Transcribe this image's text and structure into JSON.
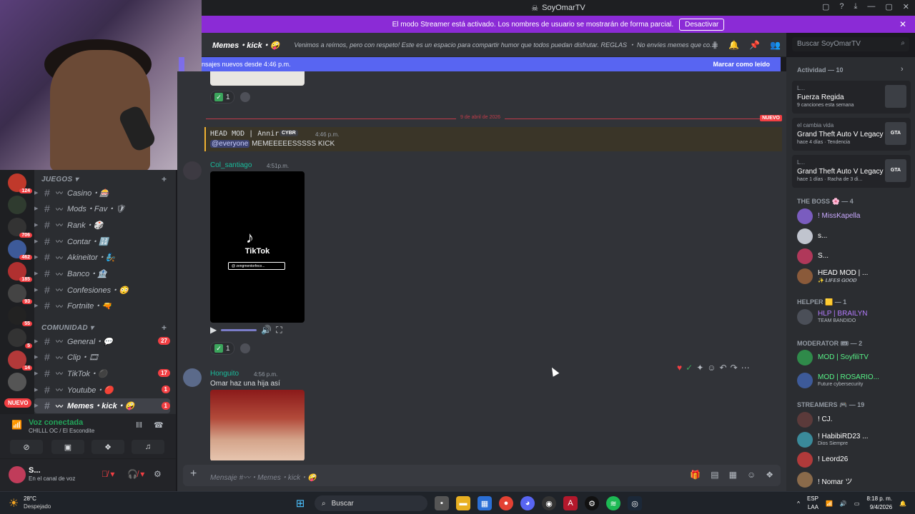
{
  "window": {
    "title": "SoyOmarTV",
    "controls": [
      "▢",
      "?",
      "⤓",
      "—",
      "▢",
      "✕"
    ]
  },
  "streamer_banner": {
    "text": "El modo Streamer está activado. Los nombres de usuario se mostrarán de forma parcial.",
    "button": "Desactivar"
  },
  "channel_header": {
    "name": "Memes・kick・🤪",
    "topic": "Venimos a reírnos, pero con respeto! Este es un espacio para compartir humor que todos puedan disfrutar. REGLAS ・ No envíes memes que co...",
    "search_placeholder": "Buscar SoyOmarTV"
  },
  "new_messages": {
    "text": "nsajes nuevos desde 4:46 p.m.",
    "action": "Marcar como leído"
  },
  "servers": [
    {
      "badge": "124",
      "color": "#c0392b"
    },
    {
      "badge": "",
      "color": "#2f3b2f"
    },
    {
      "badge": "706",
      "color": "#333"
    },
    {
      "badge": "462",
      "color": "#3d5a99"
    },
    {
      "badge": "185",
      "color": "#b03030"
    },
    {
      "badge": "93",
      "color": "#444"
    },
    {
      "badge": "55",
      "color": "#222"
    },
    {
      "badge": "5",
      "color": "#333"
    },
    {
      "badge": "14",
      "color": "#b33939"
    },
    {
      "badge": "",
      "color": "#555"
    }
  ],
  "server_nuevo": "NUEVO",
  "categories": {
    "juegos": "JUEGOS",
    "comunidad": "COMUNIDAD"
  },
  "channels_juegos": [
    {
      "name": "Casino・🎰",
      "count": ""
    },
    {
      "name": "Mods・Fav・🛡",
      "count": ""
    },
    {
      "name": "Rank・🎲",
      "count": ""
    },
    {
      "name": "Contar・🔢",
      "count": ""
    },
    {
      "name": "Akineitor・🧞",
      "count": ""
    },
    {
      "name": "Banco・🏦",
      "count": ""
    },
    {
      "name": "Confesiones・😳",
      "count": ""
    },
    {
      "name": "Fortnite・🔫",
      "count": ""
    }
  ],
  "channels_comunidad": [
    {
      "name": "General・💬",
      "count": "27"
    },
    {
      "name": "Clip・🎞",
      "count": ""
    },
    {
      "name": "TikTok・⚫",
      "count": "17"
    },
    {
      "name": "Youtube・🔴",
      "count": "1"
    },
    {
      "name": "Memes・kick・🤪",
      "count": "1"
    }
  ],
  "voice": {
    "status": "Voz conectada",
    "location": "CHILLL OC / El Escondite"
  },
  "user": {
    "name": "S...",
    "status": "En el canal de voz"
  },
  "messages": {
    "reaction_count": "1",
    "date_divider": "9 de abril de 2026",
    "nuevo": "NUEVO",
    "m1": {
      "author": "HEAD MOD | Annir",
      "tag": "CYBR",
      "time": "4:46 p.m.",
      "mention": "@everyone",
      "text": "MEMEEEEESSSSS KICK"
    },
    "m2": {
      "author": "Col_santiago",
      "time": "4:51p.m.",
      "tiktok_label": "TikTok",
      "tiktok_search": "@ zengmentorfeco..."
    },
    "m3": {
      "author": "Honguito",
      "time": "4:56 p.m.",
      "text": "Omar haz una hija así"
    }
  },
  "composer": {
    "placeholder": "Mensaje #〰・Memes・kick・🤪"
  },
  "members": {
    "activity_title": "Actividad — 10",
    "activities": [
      {
        "who": "L...",
        "game": "Fuerza Regida",
        "meta": "9 canciones esta semana",
        "thumb": ""
      },
      {
        "who": "el cambia vida",
        "game": "Grand Theft Auto V Legacy",
        "meta": "hace 4 días · Tendencia",
        "thumb": "GTA"
      },
      {
        "who": "L...",
        "game": "Grand Theft Auto V Legacy",
        "meta": "hace 1 días · Racha de 3 di...",
        "thumb": "GTA"
      }
    ],
    "boss_title": "THE BOSS 🌸 — 4",
    "boss": [
      {
        "name": "! MissKapella",
        "sub": "",
        "color": "#c9a9ff"
      },
      {
        "name": "s...",
        "sub": "",
        "color": "#fff"
      },
      {
        "name": "S...",
        "sub": "",
        "color": "#fff"
      },
      {
        "name": "HEAD MOD | ...",
        "sub": "✨ 𝑳𝑰𝑭𝑬𝑺 𝑮𝑶𝑶𝑫",
        "color": "#fff"
      }
    ],
    "helper_title": "HELPER 🟨 — 1",
    "helper": [
      {
        "name": "HLP | BRAILYN",
        "sub": "TEAM BANDIDO",
        "color": "#b57cff"
      }
    ],
    "moderator_title": "MODERATOR 🎟 — 2",
    "moderator": [
      {
        "name": "MOD | SoyfiliTV",
        "sub": "",
        "color": "#57f287"
      },
      {
        "name": "MOD | ROSARIO...",
        "sub": "Future cybersecurity",
        "color": "#57f287"
      }
    ],
    "streamers_title": "STREAMERS 🎮 — 19",
    "streamers": [
      {
        "name": "! CJ.",
        "sub": "",
        "color": "#fff"
      },
      {
        "name": "! HabibiRD23 ...",
        "sub": "Dios Siempre",
        "color": "#fff"
      },
      {
        "name": "! Leord26",
        "sub": "",
        "color": "#fff"
      },
      {
        "name": "! Nomar ツ",
        "sub": "",
        "color": "#fff"
      }
    ]
  },
  "taskbar": {
    "temp": "28°C",
    "condition": "Despejado",
    "search": "Buscar",
    "lang": "ESP",
    "lang2": "LAA",
    "time": "8:18 p. m.",
    "date": "9/4/2026"
  }
}
